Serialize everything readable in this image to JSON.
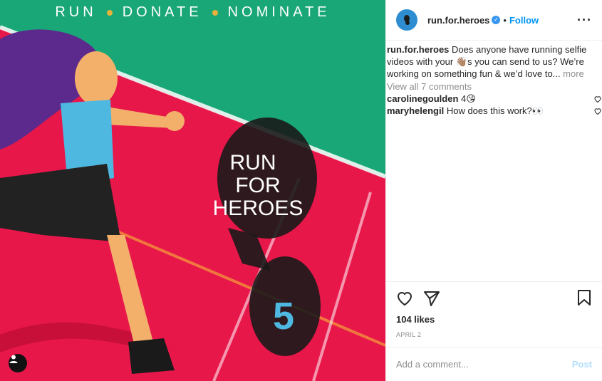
{
  "post_image": {
    "banner_words": [
      "RUN",
      "DONATE",
      "NOMINATE"
    ],
    "title_lines": [
      "RUN",
      "FOR",
      "HEROES"
    ],
    "number": "5",
    "colors": {
      "track": "#e8174a",
      "grass": "#1aa777",
      "shirt": "#4fb8e0",
      "hair": "#5b2a8c",
      "skin": "#f3b06a",
      "shorts": "#222222"
    }
  },
  "header": {
    "username": "run.for.heroes",
    "separator": "•",
    "follow_label": "Follow",
    "more_label": "···"
  },
  "caption": {
    "username": "run.for.heroes",
    "text": "Does anyone have running selfie videos with your 👋🏽s you can send to us? We’re working on something fun & we’d love to...",
    "more_label": "more"
  },
  "view_all_label": "View all 7 comments",
  "comments": [
    {
      "username": "carolinegoulden",
      "text": "4😘"
    },
    {
      "username": "maryhelengil",
      "text": "How does this work?👀"
    }
  ],
  "likes": "104 likes",
  "date": "APRIL 2",
  "add_comment": {
    "placeholder": "Add a comment...",
    "post_label": "Post"
  }
}
